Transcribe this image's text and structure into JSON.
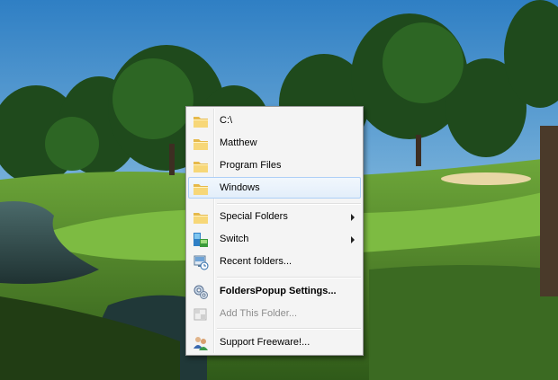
{
  "menu": {
    "items": [
      {
        "label": "C:\\",
        "icon": "folder-icon"
      },
      {
        "label": "Matthew",
        "icon": "folder-icon"
      },
      {
        "label": "Program Files",
        "icon": "folder-icon"
      },
      {
        "label": "Windows",
        "icon": "folder-icon",
        "highlighted": true
      },
      {
        "label": "Special Folders",
        "icon": "folder-icon",
        "submenu": true
      },
      {
        "label": "Switch",
        "icon": "switch-icon",
        "submenu": true
      },
      {
        "label": "Recent folders...",
        "icon": "recent-folders-icon"
      },
      {
        "label": "FoldersPopup Settings...",
        "icon": "settings-icon",
        "bold": true
      },
      {
        "label": "Add This Folder...",
        "icon": "add-folder-icon",
        "disabled": true
      },
      {
        "label": "Support Freeware!...",
        "icon": "support-users-icon"
      }
    ]
  },
  "colors": {
    "menu_background": "#f4f4f4",
    "highlight_border": "#aecff7",
    "disabled_text": "#8d8d8d"
  }
}
